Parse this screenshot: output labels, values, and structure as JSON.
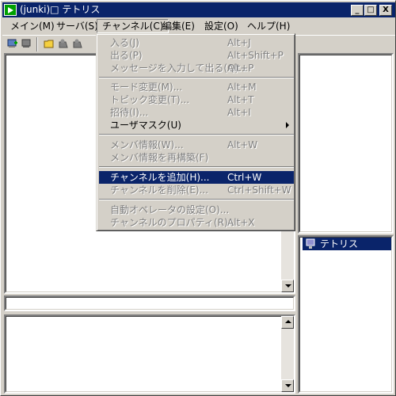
{
  "window": {
    "title": "(junki)□ テトリス",
    "minimize": "_",
    "maximize": "□",
    "close": "X"
  },
  "menubar": [
    "メイン(M)",
    "サーバ(S)",
    "チャンネル(C)",
    "編集(E)",
    "設定(O)",
    "ヘルプ(H)"
  ],
  "channel_menu": [
    {
      "label": "入る(J)",
      "shortcut": "Alt+J",
      "disabled": true
    },
    {
      "label": "出る(P)",
      "shortcut": "Alt+Shift+P",
      "disabled": true
    },
    {
      "label": "メッセージを入力して出る(Q)...",
      "shortcut": "Alt+P",
      "disabled": true
    },
    {
      "label": "モード変更(M)...",
      "shortcut": "Alt+M",
      "disabled": true
    },
    {
      "label": "トピック変更(T)...",
      "shortcut": "Alt+T",
      "disabled": true
    },
    {
      "label": "招待(I)...",
      "shortcut": "Alt+I",
      "disabled": true
    },
    {
      "label": "ユーザマスク(U)",
      "shortcut": "",
      "disabled": false
    },
    {
      "label": "メンバ情報(W)...",
      "shortcut": "Alt+W",
      "disabled": true
    },
    {
      "label": "メンバ情報を再構築(F)",
      "shortcut": "",
      "disabled": true
    },
    {
      "label": "チャンネルを追加(H)...",
      "shortcut": "Ctrl+W",
      "disabled": false,
      "highlighted": true
    },
    {
      "label": "チャンネルを削除(E)...",
      "shortcut": "Ctrl+Shift+W",
      "disabled": true
    },
    {
      "label": "自動オペレータの設定(O)...",
      "shortcut": "",
      "disabled": true
    },
    {
      "label": "チャンネルのプロパティ(R)...",
      "shortcut": "Alt+X",
      "disabled": true
    }
  ],
  "channel_list": [
    {
      "label": "テトリス",
      "selected": true
    }
  ],
  "colors": {
    "titlebar": "#0a246a",
    "face": "#d4d0c8",
    "highlight": "#0a246a",
    "disabled_text": "#808080"
  }
}
